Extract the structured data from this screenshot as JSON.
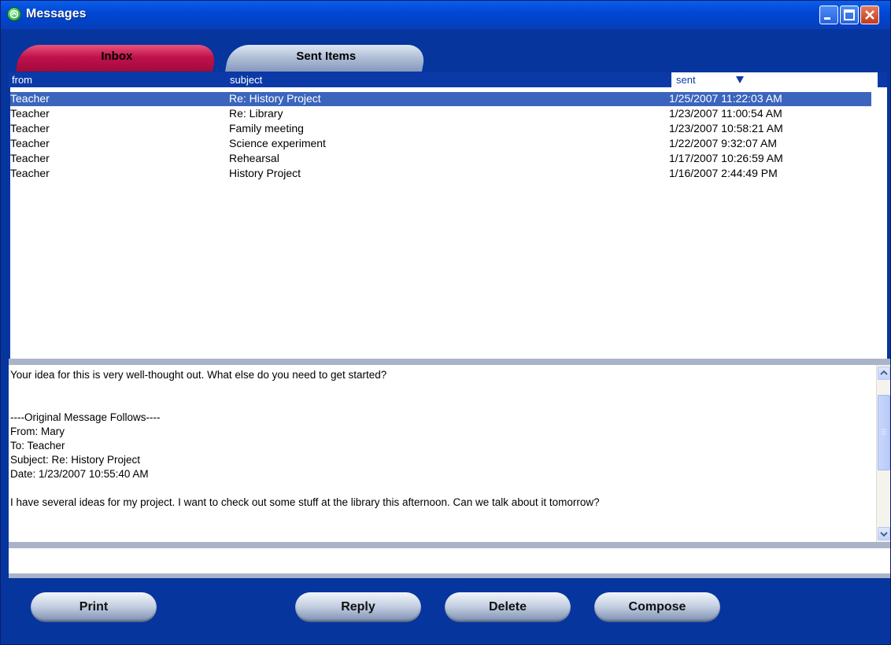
{
  "window": {
    "title": "Messages"
  },
  "tabs": [
    {
      "label": "Inbox"
    },
    {
      "label": "Sent Items"
    }
  ],
  "columns": {
    "from": "from",
    "subject": "subject",
    "sent": "sent"
  },
  "messages": [
    {
      "from": "Teacher",
      "subject": "Re: History Project",
      "sent": "1/25/2007 11:22:03 AM",
      "selected": true
    },
    {
      "from": "Teacher",
      "subject": "Re: Library",
      "sent": "1/23/2007 11:00:54 AM"
    },
    {
      "from": "Teacher",
      "subject": "Family meeting",
      "sent": "1/23/2007 10:58:21 AM"
    },
    {
      "from": "Teacher",
      "subject": "Science experiment",
      "sent": "1/22/2007 9:32:07 AM"
    },
    {
      "from": "Teacher",
      "subject": "Rehearsal",
      "sent": "1/17/2007 10:26:59 AM"
    },
    {
      "from": "Teacher",
      "subject": "History Project",
      "sent": "1/16/2007 2:44:49 PM"
    }
  ],
  "preview": {
    "body": "Your idea for this is very well-thought out. What else do you need to get started?\n\n\n----Original Message Follows----\nFrom: Mary\nTo: Teacher\nSubject: Re: History Project\nDate: 1/23/2007 10:55:40 AM\n\nI have several ideas for my project. I want to check out some stuff at the library this afternoon. Can we talk about it tomorrow?"
  },
  "buttons": {
    "print": "Print",
    "reply": "Reply",
    "delete": "Delete",
    "compose": "Compose"
  },
  "colors": {
    "frame": "#06359e",
    "inbox_tab": "#c0124c",
    "selection": "#3b65bd"
  },
  "icons": {
    "app": "messages-app-icon",
    "sort": "sort-descending-icon"
  }
}
